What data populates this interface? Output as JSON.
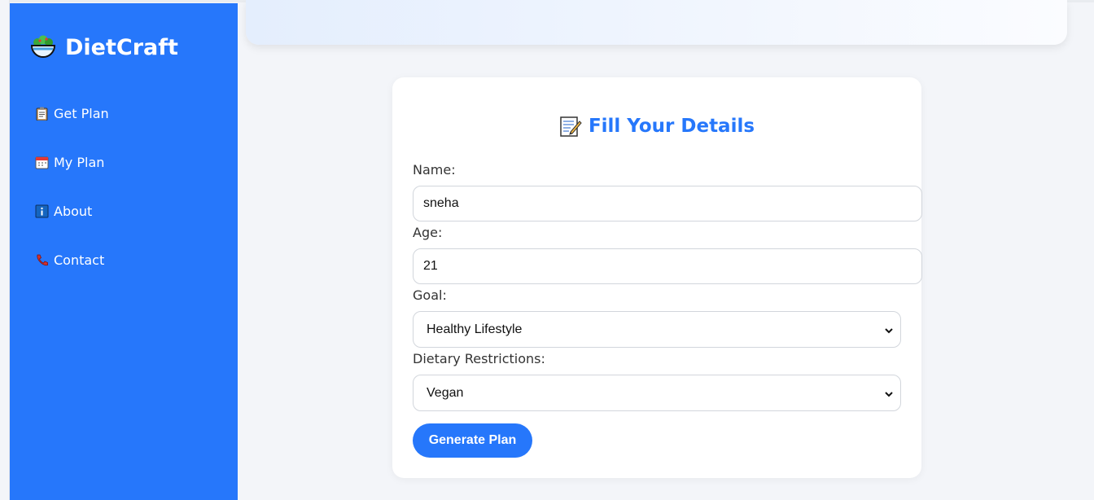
{
  "brand": {
    "name": "DietCraft",
    "logo_icon": "salad-bowl-icon"
  },
  "nav": {
    "items": [
      {
        "label": "Get Plan",
        "icon": "clipboard-icon"
      },
      {
        "label": "My Plan",
        "icon": "calendar-icon"
      },
      {
        "label": "About",
        "icon": "info-icon"
      },
      {
        "label": "Contact",
        "icon": "phone-icon"
      }
    ]
  },
  "form": {
    "title": "Fill Your Details",
    "title_icon": "memo-icon",
    "name_label": "Name:",
    "name_value": "sneha",
    "age_label": "Age:",
    "age_value": "21",
    "goal_label": "Goal:",
    "goal_value": "Healthy Lifestyle",
    "diet_label": "Dietary Restrictions:",
    "diet_value": "Vegan",
    "submit_label": "Generate Plan"
  },
  "colors": {
    "accent": "#2677fb",
    "page_bg": "#f3f5f9",
    "card_bg": "#ffffff"
  }
}
